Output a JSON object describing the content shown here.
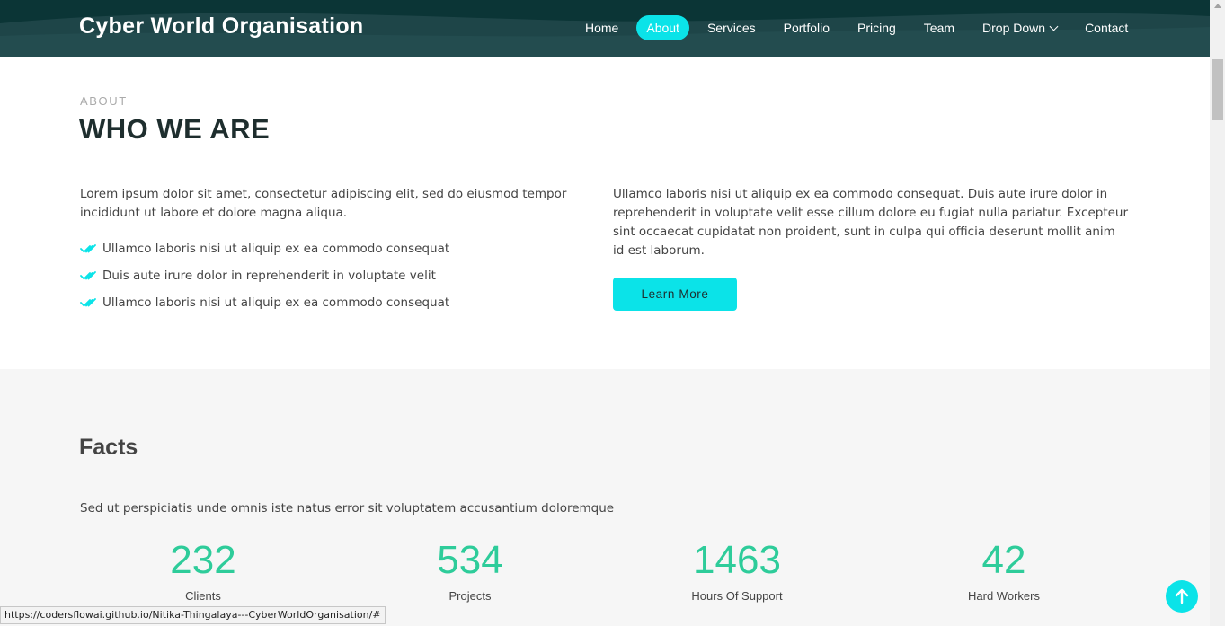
{
  "header": {
    "logo": "Cyber World Organisation",
    "nav": [
      {
        "label": "Home"
      },
      {
        "label": "About",
        "active": true
      },
      {
        "label": "Services"
      },
      {
        "label": "Portfolio"
      },
      {
        "label": "Pricing"
      },
      {
        "label": "Team"
      },
      {
        "label": "Drop Down",
        "dropdown": true
      },
      {
        "label": "Contact"
      }
    ]
  },
  "about": {
    "label": "ABOUT",
    "title": "WHO WE ARE",
    "intro": "Lorem ipsum dolor sit amet, consectetur adipiscing elit, sed do eiusmod tempor incididunt ut labore et dolore magna aliqua.",
    "checklist": [
      "Ullamco laboris nisi ut aliquip ex ea commodo consequat",
      "Duis aute irure dolor in reprehenderit in voluptate velit",
      "Ullamco laboris nisi ut aliquip ex ea commodo consequat"
    ],
    "right_text": "Ullamco laboris nisi ut aliquip ex ea commodo consequat. Duis aute irure dolor in reprehenderit in voluptate velit esse cillum dolore eu fugiat nulla pariatur. Excepteur sint occaecat cupidatat non proident, sunt in culpa qui officia deserunt mollit anim id est laborum.",
    "button": "Learn More"
  },
  "facts": {
    "title": "Facts",
    "subtitle": "Sed ut perspiciatis unde omnis iste natus error sit voluptatem accusantium doloremque",
    "counters": [
      {
        "value": "232",
        "label": "Clients"
      },
      {
        "value": "534",
        "label": "Projects"
      },
      {
        "value": "1463",
        "label": "Hours Of Support"
      },
      {
        "value": "42",
        "label": "Hard Workers"
      }
    ]
  },
  "status_url": "https://codersflowai.github.io/Nitika-Thingalaya---CyberWorldOrganisation/#",
  "icons": {
    "check": "double-check-icon",
    "back_to_top": "arrow-up-icon",
    "dropdown": "chevron-down-icon"
  },
  "colors": {
    "accent": "#0be3e8",
    "header": "#1e4548",
    "counter": "#2ecc9a"
  }
}
